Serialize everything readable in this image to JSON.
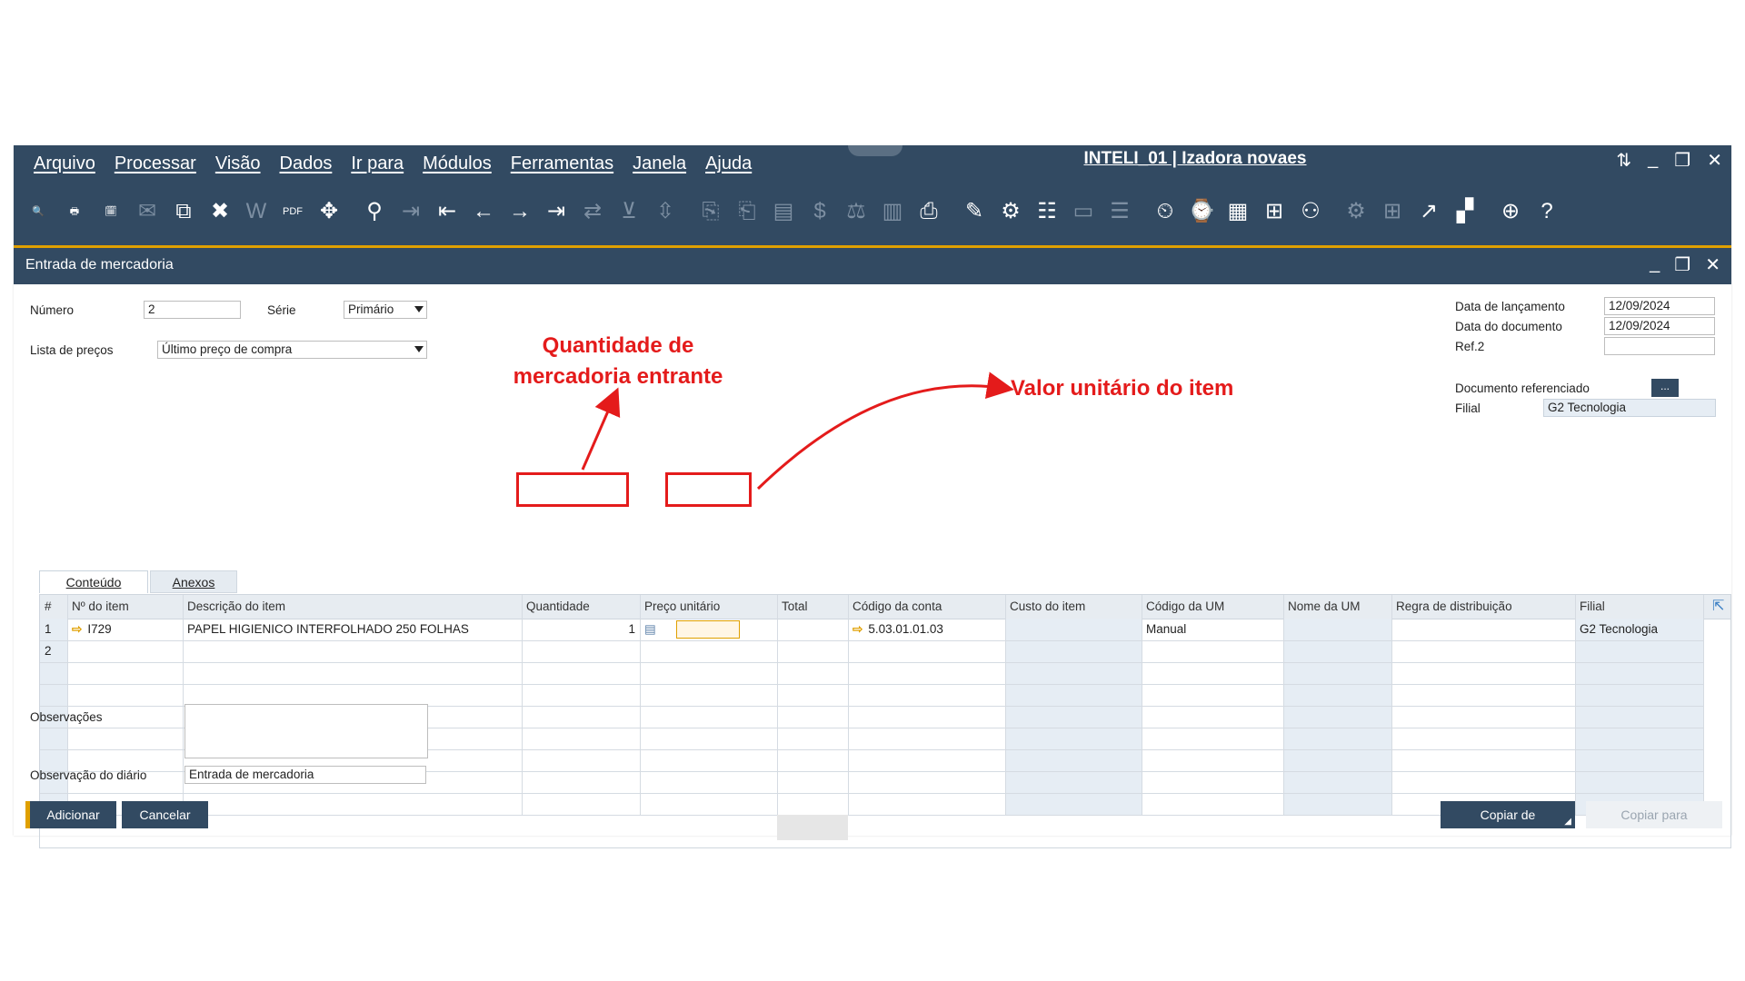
{
  "menubar": {
    "items": [
      "Arquivo",
      "Processar",
      "Visão",
      "Dados",
      "Ir para",
      "Módulos",
      "Ferramentas",
      "Janela",
      "Ajuda"
    ],
    "title": "INTELI_01 | Izadora novaes"
  },
  "window": {
    "title": "Entrada de mercadoria"
  },
  "form": {
    "numero_label": "Número",
    "numero_value": "2",
    "serie_label": "Série",
    "serie_value": "Primário",
    "lista_label": "Lista de preços",
    "lista_value": "Último preço de compra",
    "data_lanc_label": "Data de lançamento",
    "data_lanc_value": "12/09/2024",
    "data_doc_label": "Data do documento",
    "data_doc_value": "12/09/2024",
    "ref2_label": "Ref.2",
    "ref2_value": "",
    "doc_ref_label": "Documento referenciado",
    "doc_ref_button": "...",
    "filial_label": "Filial",
    "filial_value": "G2 Tecnologia"
  },
  "tabs": [
    "Conteúdo",
    "Anexos"
  ],
  "grid": {
    "columns": [
      "#",
      "Nº do item",
      "Descrição do item",
      "Quantidade",
      "Preço unitário",
      "Total",
      "Código da conta",
      "Custo do item",
      "Código da UM",
      "Nome da UM",
      "Regra de distribuição",
      "Filial"
    ],
    "rows": [
      {
        "n": "1",
        "item": "I729",
        "desc": "PAPEL HIGIENICO INTERFOLHADO 250 FOLHAS",
        "qty": "1",
        "price": "",
        "total": "",
        "account": "5.03.01.01.03",
        "cost": "",
        "um_code": "Manual",
        "um_name": "",
        "rule": "",
        "filial": "G2 Tecnologia"
      },
      {
        "n": "2",
        "item": "",
        "desc": "",
        "qty": "",
        "price": "",
        "total": "",
        "account": "",
        "cost": "",
        "um_code": "",
        "um_name": "",
        "rule": "",
        "filial": ""
      }
    ]
  },
  "bottom": {
    "obs_label": "Observações",
    "obs_value": "",
    "obs_diario_label": "Observação do diário",
    "obs_diario_value": "Entrada de mercadoria",
    "add_button": "Adicionar",
    "cancel_button": "Cancelar",
    "copy_from_button": "Copiar de",
    "copy_to_button": "Copiar para"
  },
  "annotations": {
    "quantity": [
      "Quantidade de",
      "mercadoria entrante"
    ],
    "unit_price": "Valor unitário do item"
  },
  "colors": {
    "titlebar": "#324a62",
    "accent": "#e0a000",
    "annotation": "#e41b1b"
  }
}
